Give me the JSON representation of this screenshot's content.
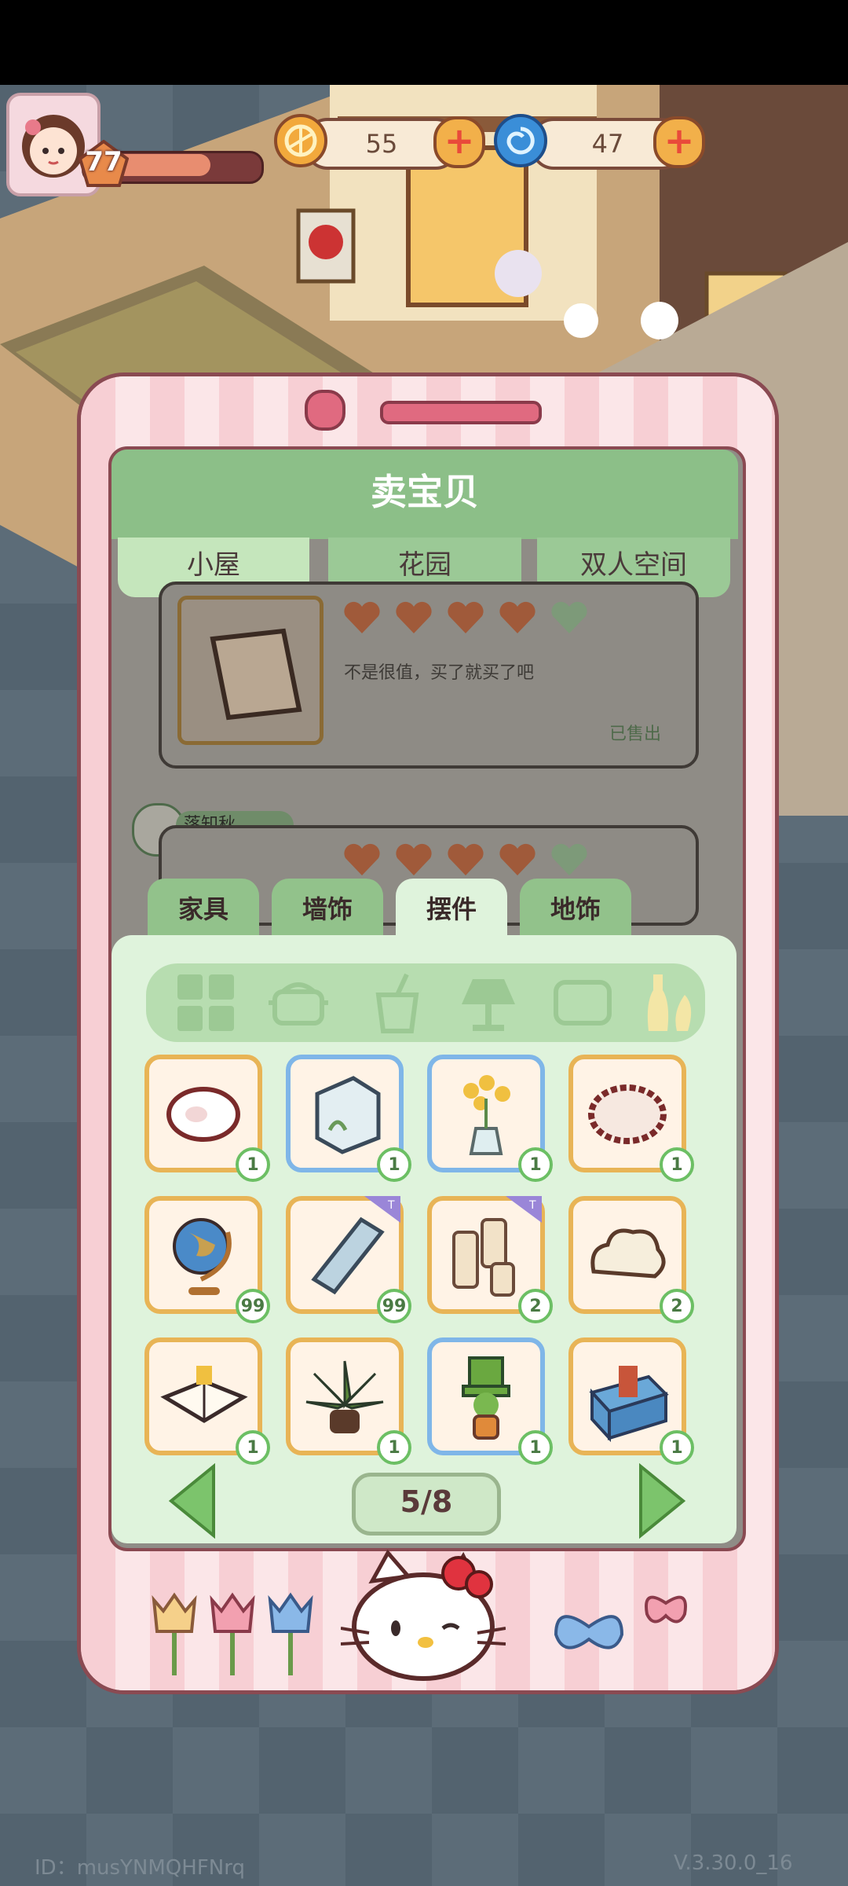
{
  "hud": {
    "level": "77",
    "coins": "55",
    "gems": "47"
  },
  "panel": {
    "title": "卖宝贝",
    "tabs": [
      "小屋",
      "花园",
      "双人空间"
    ]
  },
  "listings": [
    {
      "desc": "不是很值，买了就买了吧",
      "status": "已售出"
    },
    {
      "user": "落知秋"
    }
  ],
  "inventory": {
    "tabs": [
      "家具",
      "墙饰",
      "摆件",
      "地饰"
    ],
    "active_tab": "摆件",
    "items": [
      {
        "icon": "sheep-plush-icon",
        "count": "1"
      },
      {
        "icon": "glass-terrarium-icon",
        "count": "1"
      },
      {
        "icon": "flower-vase-icon",
        "count": "1"
      },
      {
        "icon": "fluffy-sheep-icon",
        "count": "1"
      },
      {
        "icon": "globe-icon",
        "count": "99"
      },
      {
        "icon": "mirror-frame-icon",
        "count": "99"
      },
      {
        "icon": "candles-icon",
        "count": "2"
      },
      {
        "icon": "cloud-cushion-icon",
        "count": "2"
      },
      {
        "icon": "open-book-icon",
        "count": "1"
      },
      {
        "icon": "potted-plant-icon",
        "count": "1"
      },
      {
        "icon": "top-hat-plant-icon",
        "count": "1"
      },
      {
        "icon": "toolbox-icon",
        "count": "1"
      }
    ],
    "page": "5/8"
  },
  "footer": {
    "id": "ID：musYNMQHFNrq",
    "version": "V.3.30.0_16"
  }
}
